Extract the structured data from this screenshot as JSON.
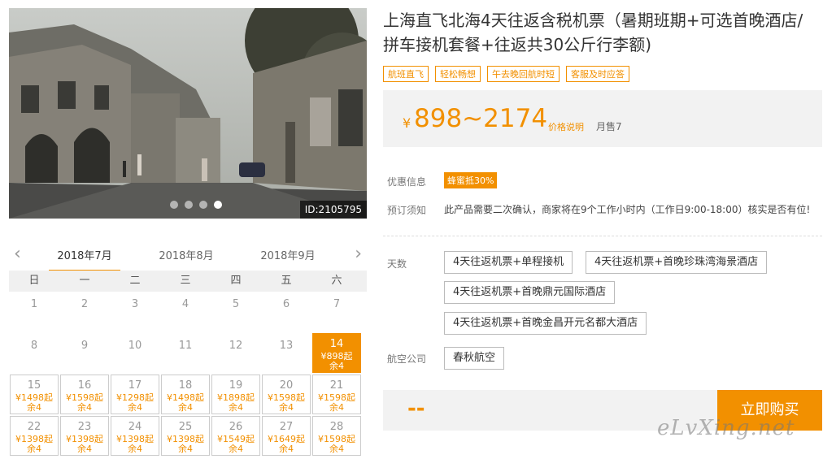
{
  "hero": {
    "id_label": "ID:2105795",
    "slide_count": 4,
    "active_slide": 4
  },
  "months": {
    "prev_icon": "chevron-left-icon",
    "next_icon": "chevron-right-icon",
    "tabs": [
      "2018年7月",
      "2018年8月",
      "2018年9月"
    ],
    "active": "2018年7月"
  },
  "calendar": {
    "weekdays": [
      "日",
      "一",
      "二",
      "三",
      "四",
      "五",
      "六"
    ],
    "row1": [
      "1",
      "2",
      "3",
      "4",
      "5",
      "6",
      "7"
    ],
    "row2": [
      "8",
      "9",
      "10",
      "11",
      "12",
      "13"
    ],
    "sel": {
      "day": "14",
      "price": "¥898起",
      "rem": "余4"
    },
    "row3": [
      {
        "day": "15",
        "price": "¥1498起",
        "rem": "余4"
      },
      {
        "day": "16",
        "price": "¥1598起",
        "rem": "余4"
      },
      {
        "day": "17",
        "price": "¥1298起",
        "rem": "余4"
      },
      {
        "day": "18",
        "price": "¥1498起",
        "rem": "余4"
      },
      {
        "day": "19",
        "price": "¥1898起",
        "rem": "余4"
      },
      {
        "day": "20",
        "price": "¥1598起",
        "rem": "余4"
      },
      {
        "day": "21",
        "price": "¥1598起",
        "rem": "余4"
      }
    ],
    "row4": [
      {
        "day": "22",
        "price": "¥1398起",
        "rem": "余4"
      },
      {
        "day": "23",
        "price": "¥1398起",
        "rem": "余4"
      },
      {
        "day": "24",
        "price": "¥1398起",
        "rem": "余4"
      },
      {
        "day": "25",
        "price": "¥1398起",
        "rem": "余4"
      },
      {
        "day": "26",
        "price": "¥1549起",
        "rem": "余4"
      },
      {
        "day": "27",
        "price": "¥1649起",
        "rem": "余4"
      },
      {
        "day": "28",
        "price": "¥1598起",
        "rem": "余4"
      }
    ]
  },
  "product": {
    "title": "上海直飞北海4天往返含税机票（暑期班期+可选首晚酒店/拼车接机套餐+往返共30公斤行李额)",
    "tags": [
      "航班直飞",
      "轻松畅想",
      "午去晚回航时短",
      "客服及时应答"
    ],
    "currency": "¥",
    "price": "898~2174",
    "price_note": "价格说明",
    "sold": "月售7"
  },
  "info": {
    "promo_label": "优惠信息",
    "promo_badge": "蜂蜜抵30%",
    "notice_label": "预订须知",
    "notice_text": "此产品需要二次确认，商家将在9个工作小时内（工作日9:00-18:00）核实是否有位!"
  },
  "options": {
    "days_label": "天数",
    "days": [
      "4天往返机票+单程接机",
      "4天往返机票+首晚珍珠湾海景酒店",
      "4天往返机票+首晚鼎元国际酒店",
      "4天往返机票+首晚金昌开元名都大酒店"
    ],
    "airline_label": "航空公司",
    "airline": "春秋航空"
  },
  "buy": {
    "total": "--",
    "button": "立即购买"
  },
  "watermark": "eLvXing.net",
  "colors": {
    "accent": "#f29000",
    "panel": "#f2f2f2"
  }
}
